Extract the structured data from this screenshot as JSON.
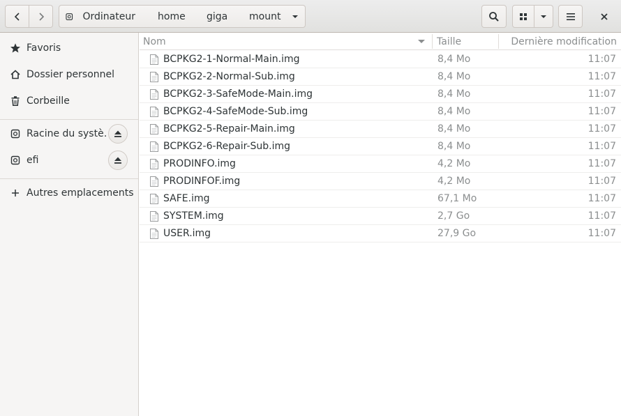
{
  "header": {
    "breadcrumb": [
      "Ordinateur",
      "home",
      "giga",
      "mount"
    ],
    "back_icon": "chevron-left-icon",
    "forward_icon": "chevron-right-icon",
    "search_icon": "search-icon",
    "view_icon": "grid-view-icon",
    "menu_icon": "hamburger-menu-icon",
    "close_icon": "close-icon"
  },
  "sidebar": {
    "items": [
      {
        "label": "Favoris",
        "icon": "star-icon"
      },
      {
        "label": "Dossier personnel",
        "icon": "home-icon"
      },
      {
        "label": "Corbeille",
        "icon": "trash-icon"
      },
      {
        "label": "Racine du systè…",
        "icon": "drive-icon"
      },
      {
        "label": "efi",
        "icon": "drive-icon"
      },
      {
        "label": "Autres emplacements",
        "icon": "plus-icon"
      }
    ]
  },
  "columns": {
    "name": "Nom",
    "size": "Taille",
    "modified": "Dernière modification"
  },
  "files": [
    {
      "name": "BCPKG2-1-Normal-Main.img",
      "size": "8,4 Mo",
      "modified": "11:07"
    },
    {
      "name": "BCPKG2-2-Normal-Sub.img",
      "size": "8,4 Mo",
      "modified": "11:07"
    },
    {
      "name": "BCPKG2-3-SafeMode-Main.img",
      "size": "8,4 Mo",
      "modified": "11:07"
    },
    {
      "name": "BCPKG2-4-SafeMode-Sub.img",
      "size": "8,4 Mo",
      "modified": "11:07"
    },
    {
      "name": "BCPKG2-5-Repair-Main.img",
      "size": "8,4 Mo",
      "modified": "11:07"
    },
    {
      "name": "BCPKG2-6-Repair-Sub.img",
      "size": "8,4 Mo",
      "modified": "11:07"
    },
    {
      "name": "PRODINFO.img",
      "size": "4,2 Mo",
      "modified": "11:07"
    },
    {
      "name": "PRODINFOF.img",
      "size": "4,2 Mo",
      "modified": "11:07"
    },
    {
      "name": "SAFE.img",
      "size": "67,1 Mo",
      "modified": "11:07"
    },
    {
      "name": "SYSTEM.img",
      "size": "2,7 Go",
      "modified": "11:07"
    },
    {
      "name": "USER.img",
      "size": "27,9 Go",
      "modified": "11:07"
    }
  ]
}
